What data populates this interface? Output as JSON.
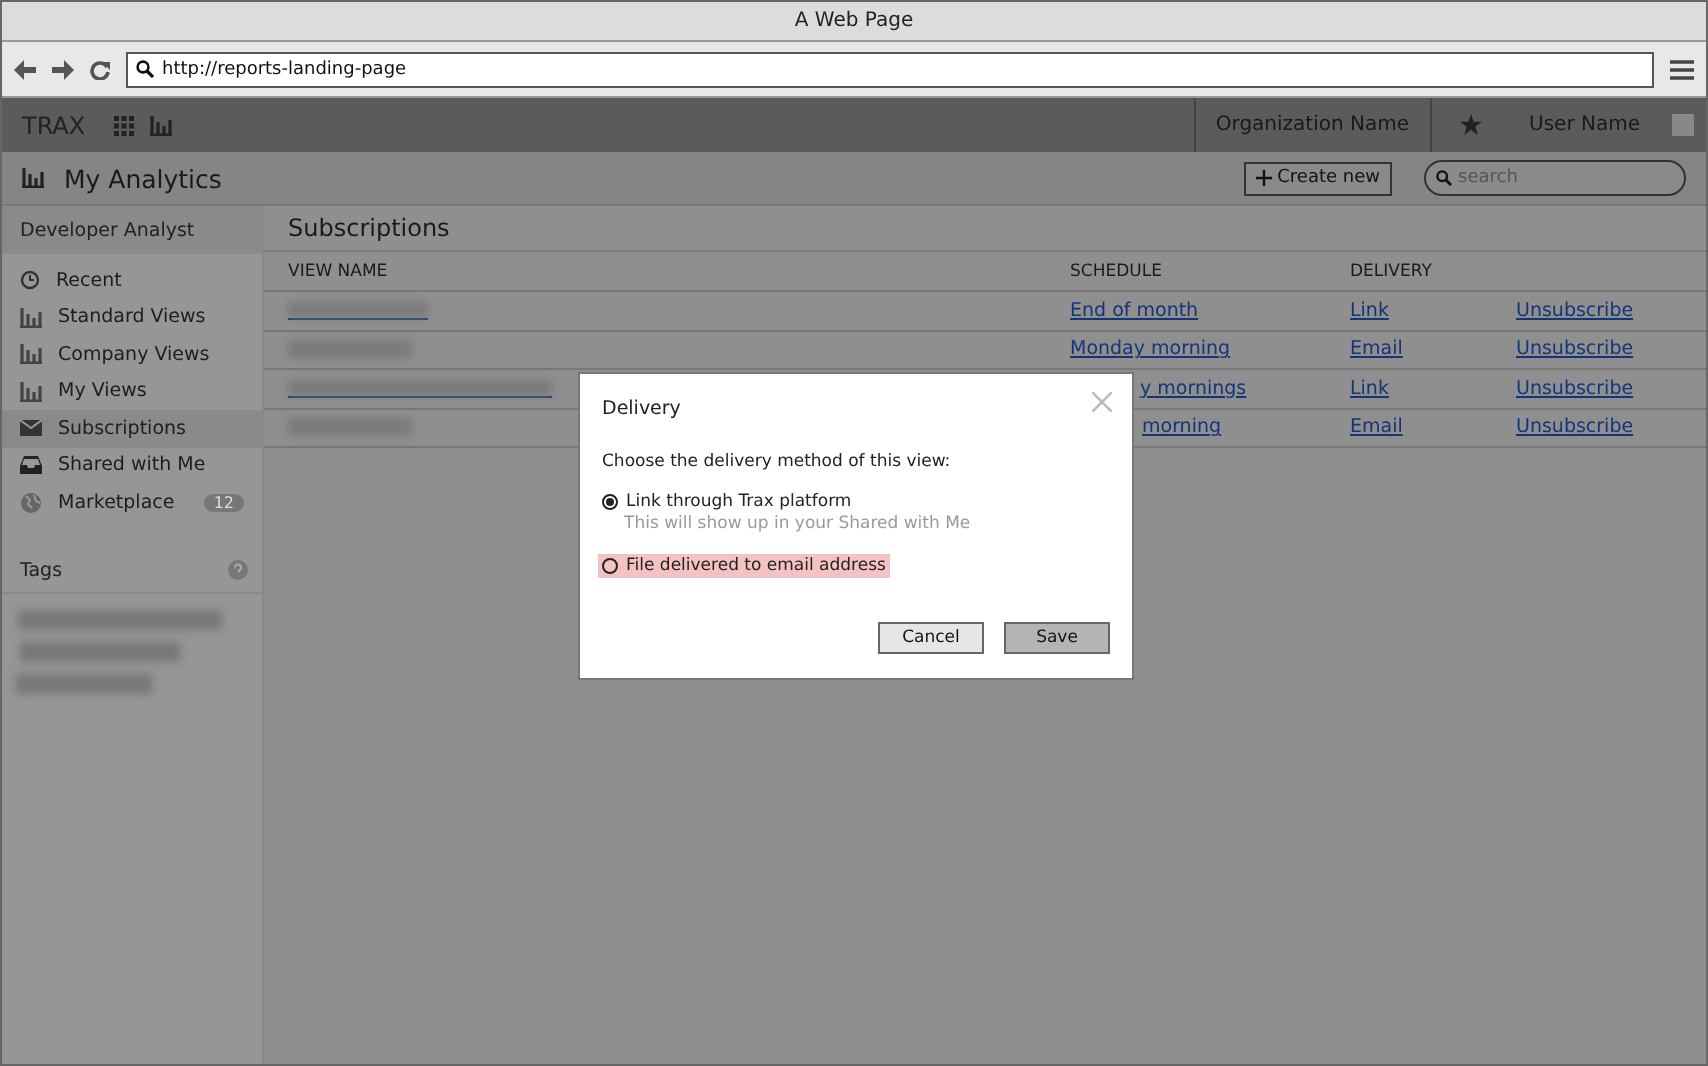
{
  "window": {
    "title": "A Web Page"
  },
  "browser": {
    "url": "http://reports-landing-page"
  },
  "topbar": {
    "brand": "TRAX",
    "organization": "Organization Name",
    "user": "User Name"
  },
  "subheader": {
    "title": "My Analytics",
    "create_button": "Create new",
    "search": {
      "placeholder": "search"
    }
  },
  "sidebar": {
    "header": "Developer Analyst",
    "items": [
      {
        "label": "Recent",
        "kind": "recent",
        "selected": false
      },
      {
        "label": "Standard Views",
        "kind": "views",
        "selected": false
      },
      {
        "label": "Company Views",
        "kind": "views",
        "selected": false
      },
      {
        "label": "My Views",
        "kind": "views",
        "selected": false
      },
      {
        "label": "Subscriptions",
        "kind": "subscriptions",
        "selected": true
      },
      {
        "label": "Shared with Me",
        "kind": "shared",
        "selected": false
      },
      {
        "label": "Marketplace",
        "kind": "marketplace",
        "selected": false,
        "badge": "12"
      }
    ],
    "tags_title": "Tags"
  },
  "content": {
    "title": "Subscriptions",
    "columns": [
      "VIEW NAME",
      "SCHEDULE",
      "DELIVERY"
    ],
    "rows": [
      {
        "name_link": true,
        "schedule": "End of month",
        "schedule_covered": false,
        "delivery": "Link",
        "action": "Unsubscribe"
      },
      {
        "name_link": false,
        "schedule": "Monday morning",
        "schedule_covered": false,
        "delivery": "Email",
        "action": "Unsubscribe"
      },
      {
        "name_link": true,
        "schedule": "y mornings",
        "schedule_covered": true,
        "delivery": "Link",
        "action": "Unsubscribe"
      },
      {
        "name_link": false,
        "schedule": "morning",
        "schedule_covered": true,
        "delivery": "Email",
        "action": "Unsubscribe"
      }
    ]
  },
  "dialog": {
    "title": "Delivery",
    "prompt": "Choose the delivery method of this view:",
    "options": [
      {
        "label": "Link through Trax platform",
        "hint": "This will show up in your Shared with Me",
        "selected": true,
        "highlighted": false
      },
      {
        "label": "File delivered to email address",
        "selected": false,
        "highlighted": true
      }
    ],
    "buttons": [
      {
        "label": "Cancel",
        "kind": "secondary"
      },
      {
        "label": "Save",
        "kind": "primary"
      }
    ]
  }
}
